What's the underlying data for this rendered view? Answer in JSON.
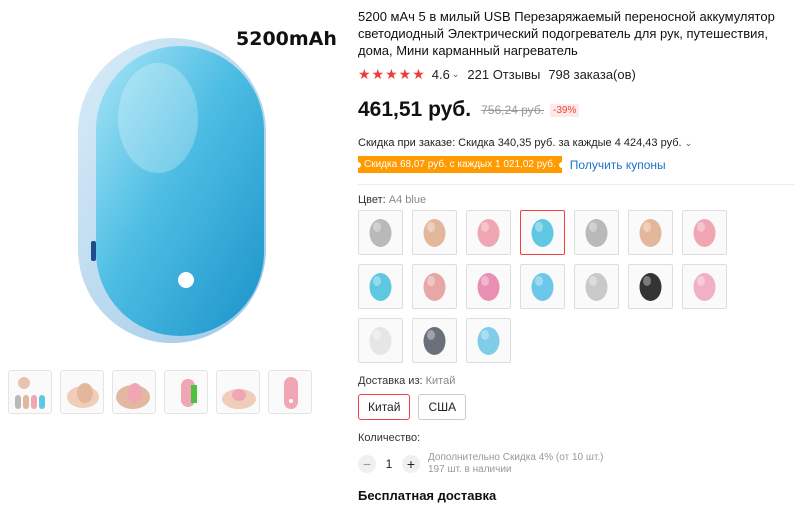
{
  "gallery": {
    "caption": "5200mAh",
    "thumbs": [
      "thumb-1",
      "thumb-2",
      "thumb-3",
      "thumb-4",
      "thumb-5",
      "thumb-6"
    ]
  },
  "product": {
    "title": "5200 мАч 5 в милый USB Перезаряжаемый переносной аккумулятор светодиодный Электрический подогреватель для рук, путешествия, дома, Мини карманный нагреватель",
    "stars": "★★★★★",
    "rating": "4.6",
    "reviews": "221 Отзывы",
    "orders": "798 заказа(ов)"
  },
  "price": {
    "current": "461,51 руб.",
    "old": "756,24 руб.",
    "discount": "-39%"
  },
  "order_discount": "Скидка при заказе: Скидка 340,35 руб. за каждые 4 424,43 руб.",
  "coupon": {
    "badge": "Скидка 68,07 руб. с каждых 1 021,02 руб.",
    "link": "Получить купоны"
  },
  "color": {
    "label": "Цвет:",
    "value": "A4 blue",
    "swatches": [
      {
        "color": "#b9b9b9"
      },
      {
        "color": "#e3b79c"
      },
      {
        "color": "#f0a7b3"
      },
      {
        "color": "#5ec8e3"
      },
      {
        "color": "#b9b9b9"
      },
      {
        "color": "#e3b79c"
      },
      {
        "color": "#f0a7b3"
      },
      {
        "color": "#5ec8e3"
      },
      {
        "color": "#e7a7a7"
      },
      {
        "color": "#e98fb3"
      },
      {
        "color": "#6cc7ea"
      },
      {
        "color": "#c9c9c9"
      },
      {
        "color": "#333333"
      },
      {
        "color": "#f2b0c6"
      },
      {
        "color": "#e6e6e6"
      },
      {
        "color": "#6b6f7a"
      },
      {
        "color": "#7fcde8"
      }
    ],
    "selected_index": 3
  },
  "shipping": {
    "label": "Доставка из:",
    "value": "Китай",
    "options": [
      "Китай",
      "США"
    ],
    "selected_index": 0
  },
  "quantity": {
    "label": "Количество:",
    "value": "1",
    "note_line1": "Дополнительно Скидка 4% (от 10 шт.)",
    "note_line2": "197 шт. в наличии"
  },
  "free_shipping": "Бесплатная доставка",
  "colors": {
    "accent": "#f0413d",
    "coupon": "#ff9a00",
    "link": "#1a73c8",
    "product_blue": "#5fc6e6"
  }
}
